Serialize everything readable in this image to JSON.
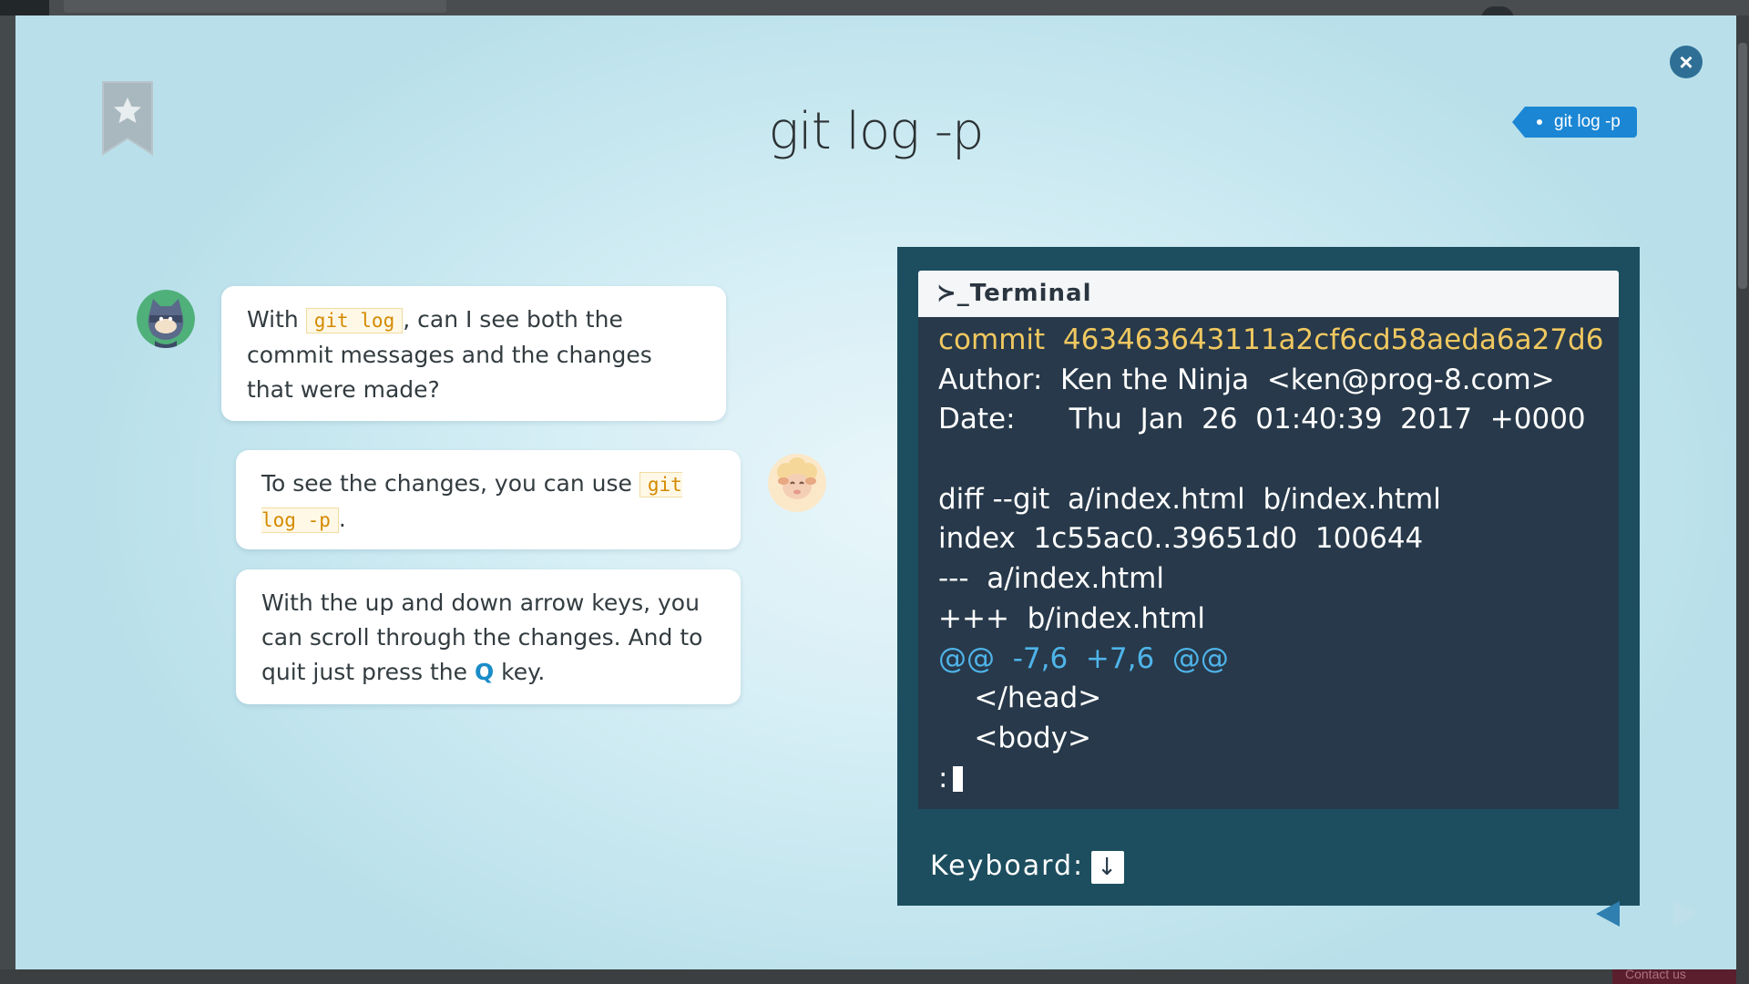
{
  "lesson": {
    "title": "git log -p",
    "tag_label": "git log -p"
  },
  "chat": [
    {
      "speaker": "ninja",
      "before": "With ",
      "code": "git log",
      "after": ", can I see both the commit messages and the changes that were made?"
    },
    {
      "speaker": "sheep",
      "before": "To see the changes, you can use ",
      "code": "git log -p",
      "after": "."
    },
    {
      "speaker": "sheep",
      "before": "With the up and down arrow keys, you can scroll through the changes. And to quit just press the ",
      "key": "Q",
      "after": " key."
    }
  ],
  "terminal": {
    "header": "Terminal",
    "prompt_symbol": "≻_",
    "lines": [
      "commit  463463643111a2cf6cd58aeda6a27d6",
      "Author:  Ken the Ninja  <ken@prog-8.com>",
      "Date:      Thu  Jan  26  01:40:39  2017  +0000",
      "",
      "diff --git  a/index.html  b/index.html",
      "index  1c55ac0..39651d0  100644",
      "---  a/index.html",
      "+++  b/index.html",
      "@@  -7,6  +7,6  @@",
      "    </head>",
      "    <body>",
      ":"
    ],
    "keyboard_label": "Keyboard:",
    "keyboard_key": "↓"
  },
  "footer": {
    "contact_label": "Contact us"
  },
  "colors": {
    "terminal_frame": "#1c4e5f",
    "terminal_body": "#27394a",
    "commit_line": "#f0c860",
    "hunk_line": "#4fb4ea",
    "tag": "#1a86d4",
    "code_text": "#d48a00"
  },
  "icons": {
    "bookmark": "bookmark-star-icon",
    "close": "close-icon",
    "prev": "prev-arrow-icon",
    "next": "next-arrow-icon"
  }
}
